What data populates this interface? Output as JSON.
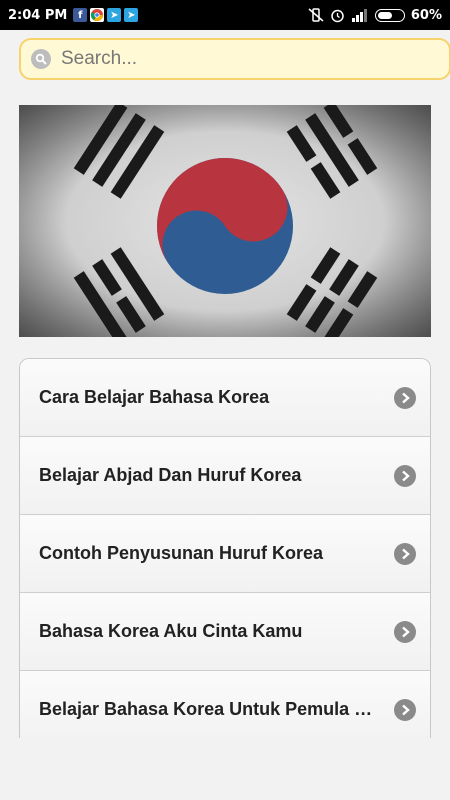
{
  "status_bar": {
    "time": "2:04 PM",
    "battery": "60%",
    "battery_level": 0.6,
    "notification_icons": [
      "facebook-icon",
      "chrome-icon",
      "telegram-icon",
      "telegram-icon"
    ]
  },
  "search": {
    "placeholder": "Search..."
  },
  "banner": {
    "image": "south-korea-flag-icon"
  },
  "menu": {
    "items": [
      {
        "label": "Cara Belajar Bahasa Korea"
      },
      {
        "label": "Belajar Abjad Dan Huruf Korea"
      },
      {
        "label": "Contoh Penyusunan Huruf Korea"
      },
      {
        "label": "Bahasa Korea Aku Cinta Kamu"
      },
      {
        "label": "Belajar Bahasa Korea Untuk Pemula Belajar Bahasa Korea Untuk Pemula"
      }
    ]
  },
  "colors": {
    "search_bg": "#fff9d6",
    "search_border": "#f6d36b",
    "flag_red": "#b8343f",
    "flag_blue": "#2f5d93"
  }
}
